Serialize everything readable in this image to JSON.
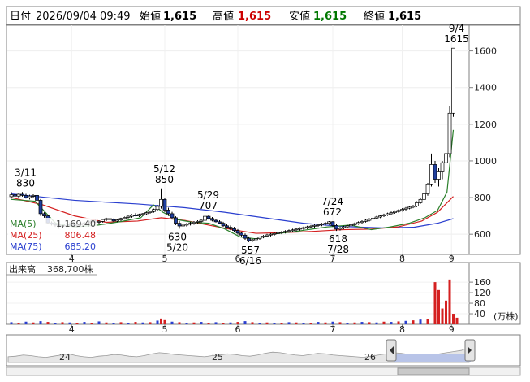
{
  "header": {
    "date_label": "日付",
    "datetime": "2026/09/04 09:49",
    "open_label": "始値",
    "open": "1,615",
    "high_label": "高値",
    "high": "1,615",
    "low_label": "安値",
    "low": "1,615",
    "close_label": "終値",
    "close": "1,615"
  },
  "colors": {
    "high": "#cc0000",
    "low": "#007700",
    "up_candle_fill": "#ffffff",
    "down_candle_fill": "#1f3fa0",
    "ma5": "#2a7f2a",
    "ma25": "#d42020",
    "ma75": "#2a3fcf",
    "volume": "#d42020",
    "volume_alt": "#2a3fcf"
  },
  "legend": {
    "ma5_label": "MA(5)",
    "ma5_value": "1,169.40",
    "ma25_label": "MA(25)",
    "ma25_value": "806.48",
    "ma75_label": "MA(75)",
    "ma75_value": "685.20"
  },
  "volume_header": {
    "label": "出来高",
    "value": "368,700株"
  },
  "volume_unit": "(万株)",
  "chart_data": {
    "type": "candlestick",
    "price_axis": {
      "ticks": [
        600,
        800,
        1000,
        1200,
        1400,
        1600
      ],
      "ylim": [
        490,
        1740
      ]
    },
    "month_labels": [
      "4",
      "5",
      "6",
      "7",
      "8",
      "9"
    ],
    "annotations": [
      {
        "date": "3/11",
        "value": "830"
      },
      {
        "date": "5/12",
        "value": "850"
      },
      {
        "date": "5/20",
        "value": "630"
      },
      {
        "date": "5/29",
        "value": "707"
      },
      {
        "date": "6/16",
        "value": "557"
      },
      {
        "date": "7/24",
        "value": "672"
      },
      {
        "date": "7/28",
        "value": "618"
      },
      {
        "date": "9/4",
        "value": "1615"
      }
    ],
    "ma_lines": {
      "ma5": [
        [
          0,
          790
        ],
        [
          15,
          780
        ],
        [
          28,
          660
        ],
        [
          40,
          640
        ],
        [
          55,
          650
        ],
        [
          70,
          670
        ],
        [
          82,
          690
        ],
        [
          90,
          760
        ],
        [
          96,
          720
        ],
        [
          105,
          680
        ],
        [
          115,
          665
        ],
        [
          125,
          660
        ],
        [
          135,
          630
        ],
        [
          145,
          585
        ],
        [
          155,
          575
        ],
        [
          165,
          600
        ],
        [
          180,
          615
        ],
        [
          200,
          640
        ],
        [
          215,
          650
        ],
        [
          228,
          625
        ],
        [
          240,
          640
        ],
        [
          252,
          660
        ],
        [
          262,
          690
        ],
        [
          270,
          730
        ],
        [
          276,
          830
        ],
        [
          280,
          1169
        ]
      ],
      "ma25": [
        [
          0,
          800
        ],
        [
          20,
          760
        ],
        [
          40,
          700
        ],
        [
          60,
          665
        ],
        [
          80,
          672
        ],
        [
          95,
          690
        ],
        [
          110,
          675
        ],
        [
          125,
          650
        ],
        [
          140,
          625
        ],
        [
          155,
          605
        ],
        [
          170,
          608
        ],
        [
          190,
          615
        ],
        [
          210,
          625
        ],
        [
          228,
          628
        ],
        [
          245,
          640
        ],
        [
          260,
          672
        ],
        [
          270,
          720
        ],
        [
          280,
          806
        ]
      ],
      "ma75": [
        [
          0,
          820
        ],
        [
          40,
          785
        ],
        [
          80,
          765
        ],
        [
          110,
          745
        ],
        [
          135,
          720
        ],
        [
          160,
          690
        ],
        [
          185,
          660
        ],
        [
          210,
          642
        ],
        [
          235,
          635
        ],
        [
          255,
          638
        ],
        [
          270,
          660
        ],
        [
          280,
          685
        ]
      ]
    },
    "candles": [
      [
        0,
        805,
        830,
        795,
        815
      ],
      [
        2,
        815,
        828,
        800,
        808
      ],
      [
        4,
        808,
        822,
        800,
        818
      ],
      [
        6,
        818,
        830,
        805,
        812
      ],
      [
        8,
        812,
        820,
        795,
        800
      ],
      [
        10,
        800,
        815,
        790,
        808
      ],
      [
        12,
        808,
        818,
        800,
        812
      ],
      [
        14,
        812,
        820,
        780,
        785
      ],
      [
        16,
        785,
        792,
        700,
        712
      ],
      [
        18,
        712,
        720,
        690,
        700
      ],
      [
        20,
        700,
        705,
        655,
        662
      ],
      [
        22,
        662,
        670,
        648,
        655
      ],
      [
        24,
        655,
        665,
        640,
        650
      ],
      [
        26,
        650,
        660,
        630,
        642
      ],
      [
        28,
        642,
        652,
        632,
        648
      ],
      [
        30,
        648,
        660,
        640,
        655
      ],
      [
        32,
        655,
        665,
        645,
        650
      ],
      [
        34,
        650,
        658,
        640,
        646
      ],
      [
        36,
        646,
        655,
        638,
        652
      ],
      [
        38,
        652,
        662,
        645,
        658
      ],
      [
        40,
        658,
        668,
        650,
        662
      ],
      [
        42,
        662,
        672,
        655,
        668
      ],
      [
        44,
        668,
        678,
        660,
        672
      ],
      [
        46,
        672,
        680,
        662,
        666
      ],
      [
        48,
        666,
        676,
        658,
        670
      ],
      [
        50,
        670,
        684,
        664,
        680
      ],
      [
        52,
        680,
        690,
        672,
        685
      ],
      [
        54,
        685,
        692,
        676,
        680
      ],
      [
        56,
        680,
        686,
        668,
        672
      ],
      [
        58,
        672,
        682,
        666,
        678
      ],
      [
        60,
        678,
        690,
        672,
        686
      ],
      [
        62,
        686,
        696,
        680,
        692
      ],
      [
        64,
        692,
        702,
        686,
        698
      ],
      [
        66,
        698,
        710,
        690,
        705
      ],
      [
        68,
        705,
        715,
        698,
        700
      ],
      [
        70,
        700,
        712,
        694,
        708
      ],
      [
        72,
        708,
        716,
        700,
        712
      ],
      [
        74,
        712,
        722,
        706,
        718
      ],
      [
        76,
        718,
        728,
        712,
        724
      ],
      [
        78,
        724,
        740,
        718,
        735
      ],
      [
        80,
        735,
        760,
        728,
        752
      ],
      [
        82,
        752,
        850,
        740,
        790
      ],
      [
        84,
        790,
        800,
        720,
        732
      ],
      [
        86,
        732,
        745,
        700,
        712
      ],
      [
        88,
        712,
        722,
        680,
        690
      ],
      [
        90,
        690,
        698,
        650,
        660
      ],
      [
        92,
        660,
        672,
        630,
        645
      ],
      [
        94,
        645,
        656,
        636,
        650
      ],
      [
        96,
        650,
        662,
        642,
        655
      ],
      [
        98,
        655,
        668,
        648,
        660
      ],
      [
        100,
        660,
        672,
        652,
        666
      ],
      [
        102,
        666,
        676,
        658,
        670
      ],
      [
        104,
        670,
        682,
        662,
        676
      ],
      [
        106,
        676,
        707,
        668,
        698
      ],
      [
        108,
        698,
        706,
        680,
        686
      ],
      [
        110,
        686,
        694,
        670,
        676
      ],
      [
        112,
        676,
        684,
        664,
        668
      ],
      [
        114,
        668,
        676,
        654,
        660
      ],
      [
        116,
        660,
        668,
        640,
        646
      ],
      [
        118,
        646,
        654,
        630,
        638
      ],
      [
        120,
        638,
        648,
        622,
        630
      ],
      [
        122,
        630,
        640,
        612,
        620
      ],
      [
        124,
        620,
        628,
        598,
        606
      ],
      [
        126,
        606,
        614,
        588,
        595
      ],
      [
        128,
        595,
        604,
        570,
        578
      ],
      [
        130,
        578,
        588,
        557,
        565
      ],
      [
        132,
        565,
        575,
        558,
        570
      ],
      [
        134,
        570,
        582,
        562,
        576
      ],
      [
        136,
        576,
        588,
        570,
        584
      ],
      [
        138,
        584,
        596,
        578,
        590
      ],
      [
        140,
        590,
        602,
        584,
        596
      ],
      [
        142,
        596,
        606,
        588,
        600
      ],
      [
        144,
        600,
        610,
        592,
        604
      ],
      [
        146,
        604,
        614,
        596,
        608
      ],
      [
        148,
        608,
        618,
        600,
        612
      ],
      [
        150,
        612,
        622,
        604,
        616
      ],
      [
        152,
        616,
        626,
        608,
        620
      ],
      [
        154,
        620,
        630,
        612,
        624
      ],
      [
        156,
        624,
        634,
        616,
        628
      ],
      [
        158,
        628,
        638,
        620,
        632
      ],
      [
        160,
        632,
        642,
        624,
        636
      ],
      [
        162,
        636,
        646,
        628,
        640
      ],
      [
        164,
        640,
        650,
        632,
        644
      ],
      [
        166,
        644,
        654,
        636,
        648
      ],
      [
        168,
        648,
        658,
        640,
        652
      ],
      [
        170,
        652,
        662,
        644,
        656
      ],
      [
        172,
        656,
        666,
        648,
        660
      ],
      [
        174,
        660,
        672,
        652,
        668
      ],
      [
        176,
        668,
        672,
        640,
        648
      ],
      [
        178,
        648,
        656,
        618,
        628
      ],
      [
        180,
        628,
        640,
        620,
        634
      ],
      [
        182,
        634,
        646,
        628,
        640
      ],
      [
        184,
        640,
        652,
        634,
        646
      ],
      [
        186,
        646,
        658,
        640,
        652
      ],
      [
        188,
        652,
        664,
        646,
        658
      ],
      [
        190,
        658,
        670,
        652,
        664
      ],
      [
        192,
        664,
        676,
        658,
        670
      ],
      [
        194,
        670,
        682,
        664,
        676
      ],
      [
        196,
        676,
        688,
        670,
        682
      ],
      [
        198,
        682,
        694,
        676,
        688
      ],
      [
        200,
        688,
        700,
        682,
        694
      ],
      [
        202,
        694,
        706,
        688,
        700
      ],
      [
        204,
        700,
        712,
        694,
        706
      ],
      [
        206,
        706,
        718,
        700,
        712
      ],
      [
        208,
        712,
        724,
        706,
        718
      ],
      [
        210,
        718,
        730,
        712,
        724
      ],
      [
        212,
        724,
        736,
        718,
        730
      ],
      [
        214,
        730,
        742,
        724,
        736
      ],
      [
        216,
        736,
        748,
        730,
        742
      ],
      [
        218,
        742,
        754,
        736,
        748
      ],
      [
        220,
        748,
        760,
        742,
        754
      ],
      [
        222,
        754,
        780,
        748,
        772
      ],
      [
        224,
        772,
        800,
        766,
        790
      ],
      [
        226,
        790,
        830,
        780,
        820
      ],
      [
        228,
        820,
        880,
        810,
        870
      ],
      [
        230,
        870,
        1040,
        860,
        980
      ],
      [
        232,
        980,
        1000,
        880,
        900
      ],
      [
        234,
        900,
        960,
        860,
        940
      ],
      [
        236,
        940,
        1000,
        900,
        990
      ],
      [
        238,
        990,
        1060,
        960,
        1040
      ],
      [
        240,
        1040,
        1300,
        1020,
        1260
      ],
      [
        242,
        1260,
        1615,
        1240,
        1615
      ]
    ],
    "volume_axis": {
      "ticks": [
        40,
        80,
        120,
        160
      ],
      "ylim": [
        0,
        185
      ]
    },
    "volume": [
      [
        0,
        8
      ],
      [
        4,
        6
      ],
      [
        8,
        10
      ],
      [
        12,
        7
      ],
      [
        16,
        12
      ],
      [
        20,
        9
      ],
      [
        24,
        6
      ],
      [
        28,
        8
      ],
      [
        32,
        7
      ],
      [
        36,
        5
      ],
      [
        40,
        9
      ],
      [
        44,
        6
      ],
      [
        48,
        11
      ],
      [
        52,
        7
      ],
      [
        56,
        5
      ],
      [
        60,
        8
      ],
      [
        64,
        6
      ],
      [
        68,
        9
      ],
      [
        72,
        7
      ],
      [
        76,
        8
      ],
      [
        80,
        14
      ],
      [
        82,
        22
      ],
      [
        84,
        16
      ],
      [
        88,
        10
      ],
      [
        92,
        8
      ],
      [
        96,
        6
      ],
      [
        100,
        7
      ],
      [
        104,
        9
      ],
      [
        108,
        5
      ],
      [
        112,
        8
      ],
      [
        116,
        6
      ],
      [
        120,
        7
      ],
      [
        124,
        9
      ],
      [
        128,
        12
      ],
      [
        132,
        8
      ],
      [
        136,
        6
      ],
      [
        140,
        7
      ],
      [
        144,
        5
      ],
      [
        148,
        6
      ],
      [
        152,
        8
      ],
      [
        156,
        7
      ],
      [
        160,
        5
      ],
      [
        164,
        6
      ],
      [
        168,
        9
      ],
      [
        172,
        7
      ],
      [
        176,
        10
      ],
      [
        180,
        8
      ],
      [
        184,
        6
      ],
      [
        188,
        7
      ],
      [
        192,
        9
      ],
      [
        196,
        8
      ],
      [
        200,
        7
      ],
      [
        204,
        10
      ],
      [
        208,
        9
      ],
      [
        212,
        11
      ],
      [
        216,
        13
      ],
      [
        220,
        15
      ],
      [
        224,
        18
      ],
      [
        228,
        20
      ],
      [
        232,
        160
      ],
      [
        234,
        130
      ],
      [
        236,
        60
      ],
      [
        238,
        90
      ],
      [
        240,
        170
      ],
      [
        242,
        40
      ],
      [
        244,
        25
      ]
    ],
    "navigator": {
      "labels": [
        "24",
        "25",
        "26"
      ],
      "series": [
        55,
        56,
        58,
        57,
        55,
        54,
        56,
        58,
        60,
        57,
        55,
        54,
        56,
        57,
        59,
        58,
        56,
        55,
        57,
        60,
        62,
        61,
        59,
        58,
        57,
        56,
        55,
        57,
        58,
        60,
        59,
        57,
        56,
        58,
        61,
        63,
        62,
        60,
        58,
        57,
        59,
        61,
        60,
        58,
        57,
        56,
        55,
        54,
        56,
        58,
        60,
        62,
        61,
        59,
        57,
        56,
        58,
        60,
        62,
        64,
        66,
        72
      ]
    }
  }
}
